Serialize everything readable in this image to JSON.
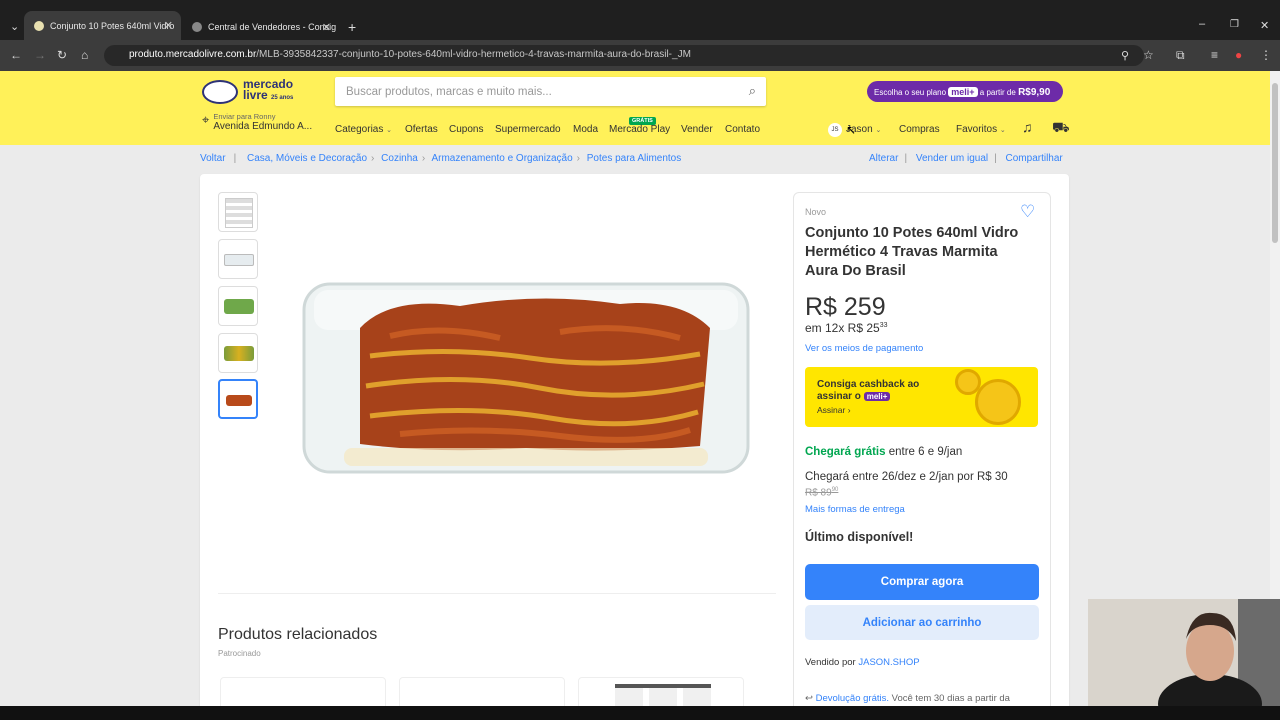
{
  "browser": {
    "tabs": [
      {
        "label": "Conjunto 10 Potes 640ml Vidro",
        "active": true
      },
      {
        "label": "Central de Vendedores - Consig",
        "active": false
      }
    ],
    "url_domain": "produto.mercadolivre.com.br",
    "url_path": "/MLB-3935842337-conjunto-10-potes-640ml-vidro-hermetico-4-travas-marmita-aura-do-brasil-_JM"
  },
  "header": {
    "logo_top": "mercado",
    "logo_bottom": "livre",
    "logo_years": "25 anos",
    "search_placeholder": "Buscar produtos, marcas e muito mais...",
    "promo_text": "Escolha o seu plano",
    "promo_brand": "meli+",
    "promo_from": "a partir de",
    "promo_price": "R$9,90",
    "location_label": "Enviar para Ronny",
    "location_address": "Avenida Edmundo A...",
    "nav": [
      "Categorias",
      "Ofertas",
      "Cupons",
      "Supermercado",
      "Moda",
      "Mercado Play",
      "Vender",
      "Contato"
    ],
    "gratis_badge": "GRÁTIS",
    "user_initials": "JS",
    "user_name": "Jason",
    "purchases": "Compras",
    "favorites": "Favoritos"
  },
  "breadcrumbs": {
    "back": "Voltar",
    "items": [
      "Casa, Móveis e Decoração",
      "Cozinha",
      "Armazenamento e Organização",
      "Potes para Alimentos"
    ],
    "actions": [
      "Alterar",
      "Vender um igual",
      "Compartilhar"
    ]
  },
  "product": {
    "condition": "Novo",
    "title": "Conjunto 10 Potes 640ml Vidro Hermético 4 Travas Marmita Aura Do Brasil",
    "price": "R$ 259",
    "installments": "em 12x R$ 25",
    "installments_cents": "33",
    "payment_link": "Ver os meios de pagamento",
    "cashback_line1": "Consiga cashback ao",
    "cashback_line2": "assinar o",
    "cashback_brand": "meli+",
    "cashback_cta": "Assinar ›",
    "ship_free_label": "Chegará grátis",
    "ship_free_dates": "entre 6 e 9/jan",
    "ship_paid": "Chegará entre 26/dez e 2/jan por R$ 30",
    "ship_old_price": "R$ 89",
    "ship_old_cents": "90",
    "ship_more": "Mais formas de entrega",
    "stock": "Último disponível!",
    "buy_button": "Comprar agora",
    "cart_button": "Adicionar ao carrinho",
    "seller_prefix": "Vendido por",
    "seller_name": "JASON.SHOP",
    "return_label": "Devolução grátis.",
    "return_text": "Você tem 30 dias a partir da"
  },
  "related": {
    "title": "Produtos relacionados",
    "sponsored": "Patrocinado"
  },
  "colors": {
    "header_yellow": "#fff159",
    "link_blue": "#3483fa",
    "free_green": "#00a650",
    "meli_purple": "#6d2ba8"
  }
}
